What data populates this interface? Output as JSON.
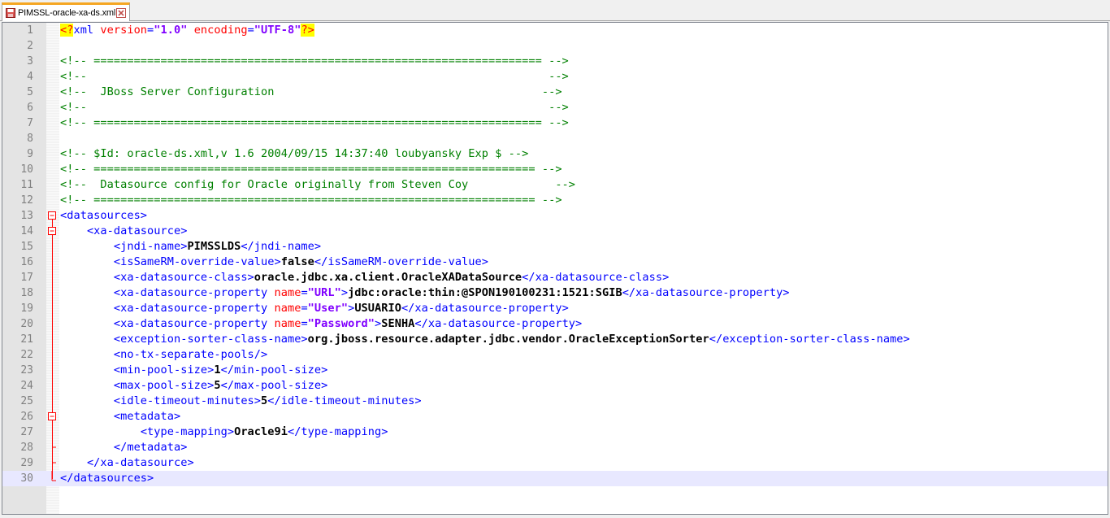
{
  "tab": {
    "filename": "PIMSSL-oracle-xa-ds.xml",
    "icon": "save-disk-icon",
    "close_icon": "close-icon"
  },
  "editor": {
    "current_line": 30,
    "lines": [
      {
        "n": "1",
        "segs": [
          [
            "p",
            "<?"
          ],
          [
            "t",
            "xml "
          ],
          [
            "a",
            "version"
          ],
          [
            "t",
            "="
          ],
          [
            "v",
            "\"1.0\""
          ],
          [
            "t",
            " "
          ],
          [
            "a",
            "encoding"
          ],
          [
            "t",
            "="
          ],
          [
            "v",
            "\"UTF-8\""
          ],
          [
            "p",
            "?>"
          ]
        ]
      },
      {
        "n": "2",
        "segs": []
      },
      {
        "n": "3",
        "segs": [
          [
            "c",
            "<!-- =================================================================== -->"
          ]
        ]
      },
      {
        "n": "4",
        "segs": [
          [
            "c",
            "<!--                                                                     -->"
          ]
        ]
      },
      {
        "n": "5",
        "segs": [
          [
            "c",
            "<!--  JBoss Server Configuration                                        -->"
          ]
        ]
      },
      {
        "n": "6",
        "segs": [
          [
            "c",
            "<!--                                                                     -->"
          ]
        ]
      },
      {
        "n": "7",
        "segs": [
          [
            "c",
            "<!-- =================================================================== -->"
          ]
        ]
      },
      {
        "n": "8",
        "segs": []
      },
      {
        "n": "9",
        "segs": [
          [
            "c",
            "<!-- $Id: oracle-ds.xml,v 1.6 2004/09/15 14:37:40 loubyansky Exp $ -->"
          ]
        ]
      },
      {
        "n": "10",
        "segs": [
          [
            "c",
            "<!-- ================================================================== -->"
          ]
        ]
      },
      {
        "n": "11",
        "segs": [
          [
            "c",
            "<!--  Datasource config for Oracle originally from Steven Coy             -->"
          ]
        ]
      },
      {
        "n": "12",
        "segs": [
          [
            "c",
            "<!-- ================================================================== -->"
          ]
        ]
      },
      {
        "n": "13",
        "segs": [
          [
            "t",
            "<datasources>"
          ]
        ]
      },
      {
        "n": "14",
        "segs": [
          [
            "x",
            "    "
          ],
          [
            "t",
            "<xa-datasource>"
          ]
        ]
      },
      {
        "n": "15",
        "segs": [
          [
            "x",
            "        "
          ],
          [
            "t",
            "<jndi-name>"
          ],
          [
            "x",
            "PIMSSLDS"
          ],
          [
            "t",
            "</jndi-name>"
          ]
        ]
      },
      {
        "n": "16",
        "segs": [
          [
            "x",
            "        "
          ],
          [
            "t",
            "<isSameRM-override-value>"
          ],
          [
            "x",
            "false"
          ],
          [
            "t",
            "</isSameRM-override-value>"
          ]
        ]
      },
      {
        "n": "17",
        "segs": [
          [
            "x",
            "        "
          ],
          [
            "t",
            "<xa-datasource-class>"
          ],
          [
            "x",
            "oracle.jdbc.xa.client.OracleXADataSource"
          ],
          [
            "t",
            "</xa-datasource-class>"
          ]
        ]
      },
      {
        "n": "18",
        "segs": [
          [
            "x",
            "        "
          ],
          [
            "t",
            "<xa-datasource-property "
          ],
          [
            "a",
            "name"
          ],
          [
            "t",
            "="
          ],
          [
            "v",
            "\"URL\""
          ],
          [
            "t",
            ">"
          ],
          [
            "x",
            "jdbc:oracle:thin:@SPON190100231:1521:SGIB"
          ],
          [
            "t",
            "</xa-datasource-property>"
          ]
        ]
      },
      {
        "n": "19",
        "segs": [
          [
            "x",
            "        "
          ],
          [
            "t",
            "<xa-datasource-property "
          ],
          [
            "a",
            "name"
          ],
          [
            "t",
            "="
          ],
          [
            "v",
            "\"User\""
          ],
          [
            "t",
            ">"
          ],
          [
            "x",
            "USUARIO"
          ],
          [
            "t",
            "</xa-datasource-property>"
          ]
        ]
      },
      {
        "n": "20",
        "segs": [
          [
            "x",
            "        "
          ],
          [
            "t",
            "<xa-datasource-property "
          ],
          [
            "a",
            "name"
          ],
          [
            "t",
            "="
          ],
          [
            "v",
            "\"Password\""
          ],
          [
            "t",
            ">"
          ],
          [
            "x",
            "SENHA"
          ],
          [
            "t",
            "</xa-datasource-property>"
          ]
        ]
      },
      {
        "n": "21",
        "segs": [
          [
            "x",
            "        "
          ],
          [
            "t",
            "<exception-sorter-class-name>"
          ],
          [
            "x",
            "org.jboss.resource.adapter.jdbc.vendor.OracleExceptionSorter"
          ],
          [
            "t",
            "</exception-sorter-class-name>"
          ]
        ]
      },
      {
        "n": "22",
        "segs": [
          [
            "x",
            "        "
          ],
          [
            "t",
            "<no-tx-separate-pools/>"
          ]
        ]
      },
      {
        "n": "23",
        "segs": [
          [
            "x",
            "        "
          ],
          [
            "t",
            "<min-pool-size>"
          ],
          [
            "x",
            "1"
          ],
          [
            "t",
            "</min-pool-size>"
          ]
        ]
      },
      {
        "n": "24",
        "segs": [
          [
            "x",
            "        "
          ],
          [
            "t",
            "<max-pool-size>"
          ],
          [
            "x",
            "5"
          ],
          [
            "t",
            "</max-pool-size>"
          ]
        ]
      },
      {
        "n": "25",
        "segs": [
          [
            "x",
            "        "
          ],
          [
            "t",
            "<idle-timeout-minutes>"
          ],
          [
            "x",
            "5"
          ],
          [
            "t",
            "</idle-timeout-minutes>"
          ]
        ]
      },
      {
        "n": "26",
        "segs": [
          [
            "x",
            "        "
          ],
          [
            "t",
            "<metadata>"
          ]
        ]
      },
      {
        "n": "27",
        "segs": [
          [
            "x",
            "            "
          ],
          [
            "t",
            "<type-mapping>"
          ],
          [
            "x",
            "Oracle9i"
          ],
          [
            "t",
            "</type-mapping>"
          ]
        ]
      },
      {
        "n": "28",
        "segs": [
          [
            "x",
            "        "
          ],
          [
            "t",
            "</metadata>"
          ]
        ]
      },
      {
        "n": "29",
        "segs": [
          [
            "x",
            "    "
          ],
          [
            "t",
            "</xa-datasource>"
          ]
        ]
      },
      {
        "n": "30",
        "segs": [
          [
            "t",
            "</datasources>"
          ]
        ]
      }
    ]
  },
  "folds": [
    {
      "line": 13,
      "kind": "box"
    },
    {
      "line": 14,
      "kind": "box"
    },
    {
      "line": 26,
      "kind": "box"
    },
    {
      "line": 28,
      "kind": "end"
    },
    {
      "line": 29,
      "kind": "end"
    },
    {
      "line": 30,
      "kind": "end"
    }
  ]
}
